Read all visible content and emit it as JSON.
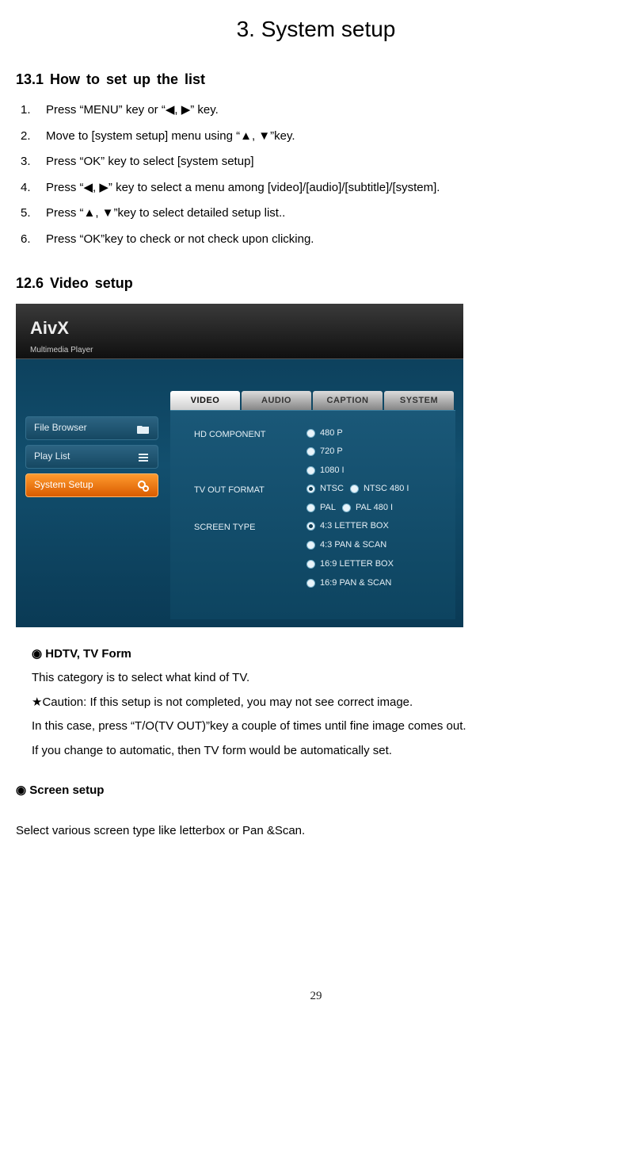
{
  "chapter_title": "3. System setup",
  "section1": {
    "heading": "13.1  How to set up the list",
    "steps": [
      "Press “MENU” key or “◀, ▶” key.",
      "Move to [system setup] menu using “▲, ▼”key.",
      "Press “OK” key to select [system setup]",
      "Press “◀, ▶” key to select a menu among [video]/[audio]/[subtitle]/[system].",
      "Press “▲, ▼”key to select detailed setup list..",
      "Press “OK”key to check or not check upon clicking."
    ]
  },
  "section2": {
    "heading": "12.6  Video setup"
  },
  "screenshot": {
    "logo_main": "AivX",
    "logo_sub": "Multimedia Player",
    "tabs": {
      "video": "VIDEO",
      "audio": "AUDIO",
      "caption": "CAPTION",
      "system": "SYSTEM"
    },
    "sidemenu": {
      "file_browser": "File Browser",
      "play_list": "Play List",
      "system_setup": "System Setup"
    },
    "groups": {
      "hd_component": {
        "label": "HD COMPONENT",
        "opts": [
          "480 P",
          "720 P",
          "1080 I"
        ],
        "selected": -1
      },
      "tv_out": {
        "label": "TV OUT FORMAT",
        "opts": [
          "NTSC",
          "NTSC 480 I",
          "PAL",
          "PAL 480 I"
        ],
        "selected": 0
      },
      "screen_type": {
        "label": "SCREEN TYPE",
        "opts": [
          "4:3 LETTER BOX",
          "4:3 PAN & SCAN",
          "16:9 LETTER BOX",
          "16:9 PAN & SCAN"
        ],
        "selected": 0
      }
    }
  },
  "body": {
    "hdtv_head": "◉ HDTV, TV Form",
    "hdtv_p1": "This category is to select what kind of TV.",
    "hdtv_p2": "★Caution: If this setup is not completed, you may not see correct image.",
    "hdtv_p3": "In this case, press “T/O(TV OUT)”key a couple of times until fine image comes out.",
    "hdtv_p4": "If you change to automatic, then TV form would be automatically set.",
    "screen_head": "◉ Screen setup",
    "screen_p1": "Select various screen type like letterbox or Pan &Scan."
  },
  "page_number": "29"
}
